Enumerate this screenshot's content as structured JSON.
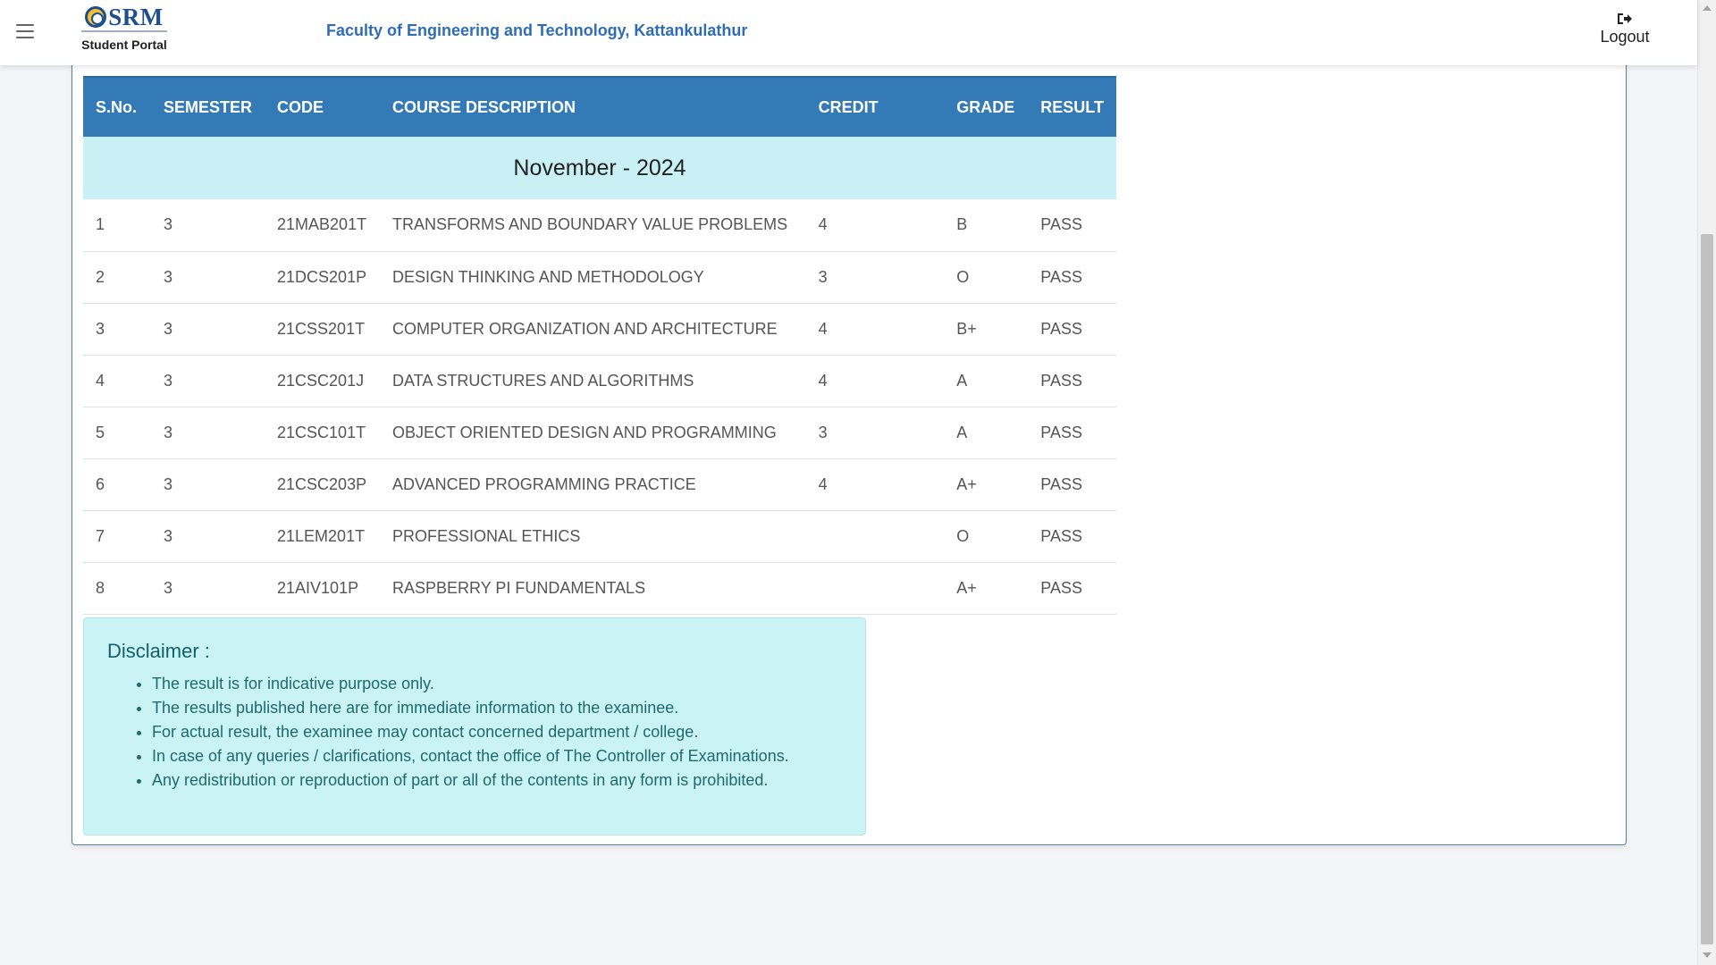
{
  "header": {
    "logo_text": "SRM",
    "portal_title": "Student Portal",
    "faculty": "Faculty of Engineering and Technology, Kattankulathur",
    "logout_label": "Logout"
  },
  "table": {
    "headers": {
      "sno": "S.No.",
      "semester": "SEMESTER",
      "code": "CODE",
      "description": "COURSE DESCRIPTION",
      "credit": "CREDIT",
      "grade": "GRADE",
      "result": "RESULT"
    },
    "session": "November - 2024",
    "rows": [
      {
        "sno": "1",
        "semester": "3",
        "code": "21MAB201T",
        "description": "TRANSFORMS AND BOUNDARY VALUE PROBLEMS",
        "credit": "4",
        "grade": "B",
        "result": "PASS"
      },
      {
        "sno": "2",
        "semester": "3",
        "code": "21DCS201P",
        "description": "DESIGN THINKING AND METHODOLOGY",
        "credit": "3",
        "grade": "O",
        "result": "PASS"
      },
      {
        "sno": "3",
        "semester": "3",
        "code": "21CSS201T",
        "description": "COMPUTER ORGANIZATION AND ARCHITECTURE",
        "credit": "4",
        "grade": "B+",
        "result": "PASS"
      },
      {
        "sno": "4",
        "semester": "3",
        "code": "21CSC201J",
        "description": "DATA STRUCTURES AND ALGORITHMS",
        "credit": "4",
        "grade": "A",
        "result": "PASS"
      },
      {
        "sno": "5",
        "semester": "3",
        "code": "21CSC101T",
        "description": "OBJECT ORIENTED DESIGN AND PROGRAMMING",
        "credit": "3",
        "grade": "A",
        "result": "PASS"
      },
      {
        "sno": "6",
        "semester": "3",
        "code": "21CSC203P",
        "description": "ADVANCED PROGRAMMING PRACTICE",
        "credit": "4",
        "grade": "A+",
        "result": "PASS"
      },
      {
        "sno": "7",
        "semester": "3",
        "code": "21LEM201T",
        "description": "PROFESSIONAL ETHICS",
        "credit": "",
        "grade": "O",
        "result": "PASS"
      },
      {
        "sno": "8",
        "semester": "3",
        "code": "21AIV101P",
        "description": "RASPBERRY PI FUNDAMENTALS",
        "credit": "",
        "grade": "A+",
        "result": "PASS"
      }
    ]
  },
  "disclaimer": {
    "title": "Disclaimer :",
    "items": [
      "The result is for indicative purpose only.",
      "The results published here are for immediate information to the examinee.",
      "For actual result, the examinee may contact concerned department / college.",
      "In case of any queries / clarifications, contact the office of The Controller of Examinations.",
      "Any redistribution or reproduction of part or all of the contents in any form is prohibited."
    ]
  },
  "icons": {
    "menu": "hamburger-menu-icon",
    "logout": "sign-out-icon",
    "logo": "srm-emblem-icon"
  },
  "colors": {
    "header_accent": "#2f6db5",
    "table_header_bg": "#337ab7",
    "session_row_bg": "#c9f1f5",
    "disclaimer_bg": "#c9f3f5"
  }
}
